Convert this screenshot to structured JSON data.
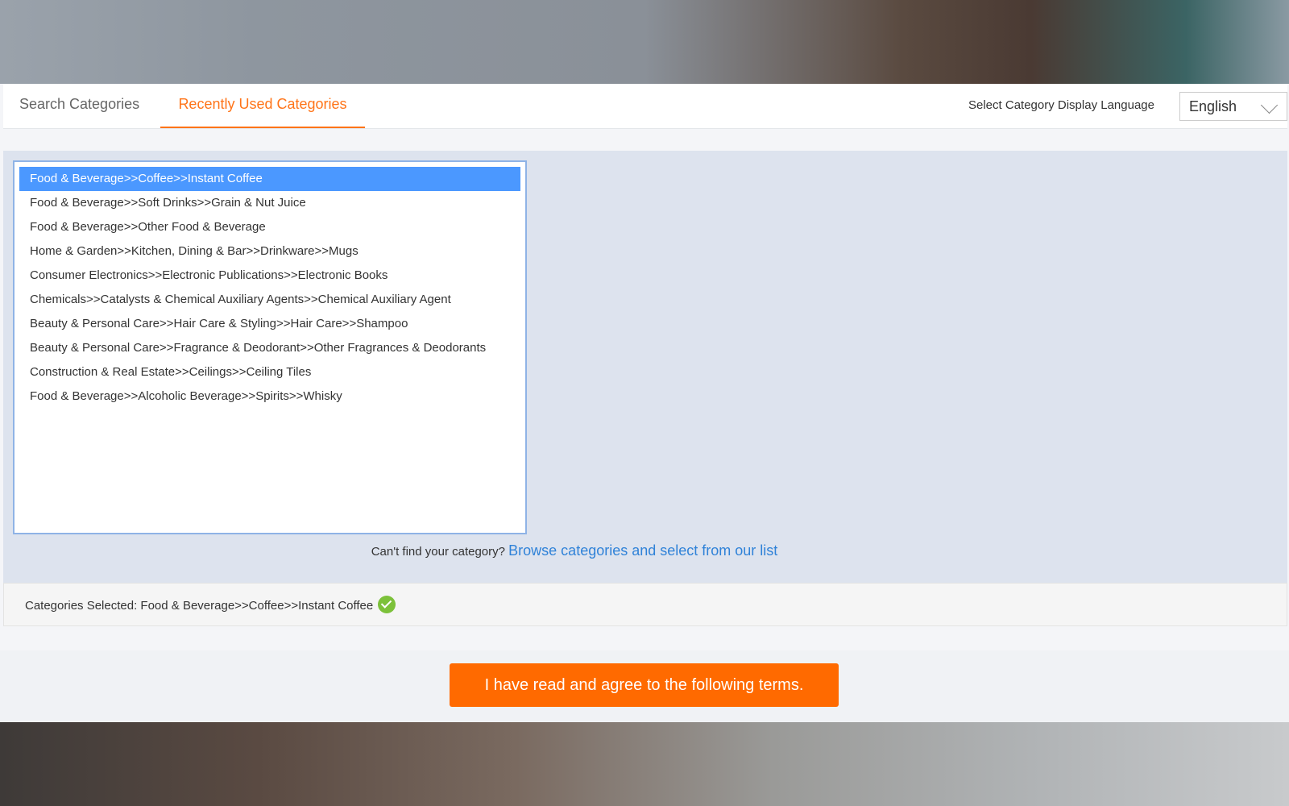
{
  "tabs": [
    {
      "label": "Search Categories"
    },
    {
      "label": "Recently Used Categories"
    }
  ],
  "language": {
    "label": "Select Category Display Language",
    "selected": "English"
  },
  "categories": [
    "Food & Beverage>>Coffee>>Instant Coffee",
    "Food & Beverage>>Soft Drinks>>Grain & Nut Juice",
    "Food & Beverage>>Other Food & Beverage",
    "Home & Garden>>Kitchen, Dining & Bar>>Drinkware>>Mugs",
    "Consumer Electronics>>Electronic Publications>>Electronic Books",
    "Chemicals>>Catalysts & Chemical Auxiliary Agents>>Chemical Auxiliary Agent",
    "Beauty & Personal Care>>Hair Care & Styling>>Hair Care>>Shampoo",
    "Beauty & Personal Care>>Fragrance & Deodorant>>Other Fragrances & Deodorants",
    "Construction & Real Estate>>Ceilings>>Ceiling Tiles",
    "Food & Beverage>>Alcoholic Beverage>>Spirits>>Whisky"
  ],
  "cant_find": {
    "text": "Can't find your category?",
    "link": "Browse categories and select from our list"
  },
  "selected": {
    "label": "Categories Selected:",
    "value": "Food & Beverage>>Coffee>>Instant Coffee"
  },
  "agree_button": "I have read and agree to the following terms."
}
